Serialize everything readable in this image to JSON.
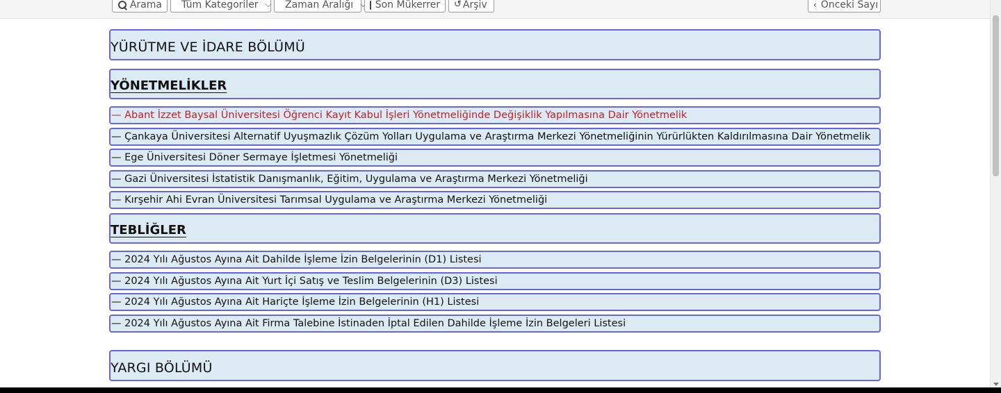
{
  "toolbar": {
    "search_label": "Arama",
    "category_label": "Tüm Kategoriler",
    "date_range_label": "Zaman Aralığı",
    "last_repeat_label": "Son Mükerrer",
    "archive_label": "Arşiv",
    "previous_issue_label": "Önceki Sayı"
  },
  "sections": {
    "executive": {
      "title": "YÜRÜTME VE İDARE BÖLÜMÜ",
      "regulations": {
        "title": "YÖNETMELİKLER",
        "items": [
          "— Abant İzzet Baysal Üniversitesi Öğrenci Kayıt Kabul İşleri Yönetmeliğinde Değişiklik Yapılmasına Dair Yönetmelik",
          "— Çankaya Üniversitesi Alternatif Uyuşmazlık Çözüm Yolları Uygulama ve Araştırma Merkezi Yönetmeliğinin Yürürlükten Kaldırılmasına Dair Yönetmelik",
          "— Ege Üniversitesi Döner Sermaye İşletmesi Yönetmeliği",
          "— Gazi Üniversitesi İstatistik Danışmanlık, Eğitim, Uygulama ve Araştırma Merkezi Yönetmeliği",
          "— Kırşehir Ahi Evran Üniversitesi Tarımsal Uygulama ve Araştırma Merkezi Yönetmeliği"
        ]
      },
      "communiques": {
        "title": "TEBLİĞLER",
        "items": [
          "— 2024 Yılı Ağustos Ayına Ait Dahilde İşleme İzin Belgelerinin (D1) Listesi",
          "— 2024 Yılı Ağustos Ayına Ait Yurt İçi Satış ve Teslim Belgelerinin (D3) Listesi",
          "— 2024 Yılı Ağustos Ayına Ait Hariçte İşleme İzin Belgelerinin (H1) Listesi",
          "— 2024 Yılı Ağustos Ayına Ait Firma Talebine İstinaden İptal Edilen Dahilde İşleme İzin Belgeleri Listesi"
        ]
      }
    },
    "judiciary": {
      "title": "YARGI BÖLÜMÜ"
    }
  },
  "colors": {
    "box_background": "#dcebf3",
    "box_border": "#6666dd",
    "active_link": "#c0202a"
  }
}
